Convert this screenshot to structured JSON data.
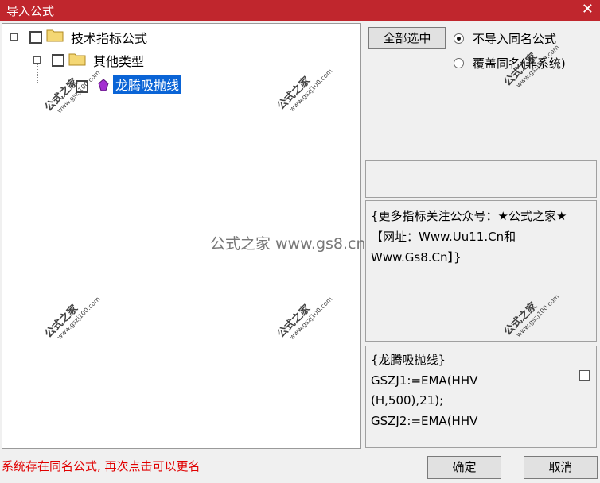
{
  "window": {
    "title": "导入公式",
    "close_glyph": "✕"
  },
  "tree": {
    "root_label": "技术指标公式",
    "child_label": "其他类型",
    "leaf_label": "龙腾吸抛线"
  },
  "options": {
    "select_all_label": "全部选中",
    "radio_no_import": "不导入同名公式",
    "radio_overwrite": "覆盖同名(非系统)",
    "selected": "radio_no_import"
  },
  "info_text": "{更多指标关注公众号：★公式之家★【网址：Www.Uu11.Cn和Www.Gs8.Cn】}",
  "code_lines": [
    "{龙腾吸抛线}",
    "GSZJ1:=EMA(HHV",
    "(H,500),21);",
    "GSZJ2:=EMA(HHV"
  ],
  "status_text": "系统存在同名公式, 再次点击可以更名",
  "buttons": {
    "ok": "确定",
    "cancel": "取消"
  },
  "watermark": {
    "center": "公式之家 www.gs8.cn",
    "title": "公式之家",
    "url": "www.gszj100.com"
  },
  "colors": {
    "titlebar": "#c0262d",
    "selection": "#0a64d6",
    "status": "#e00000"
  }
}
